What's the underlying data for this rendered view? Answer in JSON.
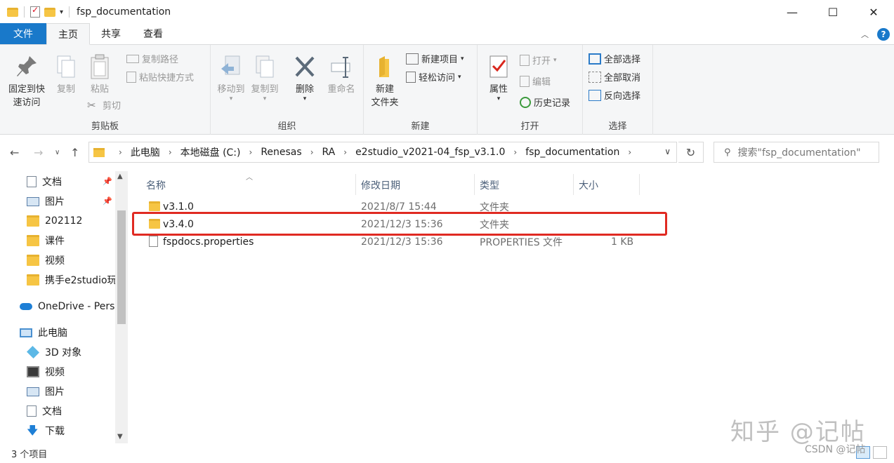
{
  "window": {
    "title": "fsp_documentation",
    "controls": {
      "minimize": "—",
      "maximize": "☐",
      "close": "✕"
    }
  },
  "tabs": [
    {
      "label": "文件"
    },
    {
      "label": "主页"
    },
    {
      "label": "共享"
    },
    {
      "label": "查看"
    }
  ],
  "ribbon": {
    "clipboard": {
      "label": "剪贴板",
      "pin_quick": "固定到快\n速访问",
      "pin_quick_line1": "固定到快",
      "pin_quick_line2": "速访问",
      "copy": "复制",
      "paste": "粘贴",
      "copy_path": "复制路径",
      "paste_shortcut": "粘贴快捷方式",
      "cut": "剪切"
    },
    "organize": {
      "label": "组织",
      "move_to": "移动到",
      "copy_to": "复制到",
      "delete": "删除",
      "rename": "重命名"
    },
    "new": {
      "label": "新建",
      "new_folder_line1": "新建",
      "new_folder_line2": "文件夹",
      "new_item": "新建项目",
      "easy_access": "轻松访问"
    },
    "open": {
      "label": "打开",
      "properties": "属性",
      "open": "打开",
      "edit": "编辑",
      "history": "历史记录"
    },
    "select": {
      "label": "选择",
      "select_all": "全部选择",
      "select_none": "全部取消",
      "invert": "反向选择"
    }
  },
  "address": {
    "breadcrumbs": [
      "此电脑",
      "本地磁盘 (C:)",
      "Renesas",
      "RA",
      "e2studio_v2021-04_fsp_v3.1.0",
      "fsp_documentation"
    ],
    "search_placeholder": "搜索\"fsp_documentation\""
  },
  "nav_pane": {
    "quick": [
      {
        "label": "文档",
        "icon": "documents-icon",
        "pinned": true
      },
      {
        "label": "图片",
        "icon": "pictures-icon",
        "pinned": true
      },
      {
        "label": "202112",
        "icon": "folder-icon",
        "pinned": false
      },
      {
        "label": "课件",
        "icon": "folder-icon",
        "pinned": false
      },
      {
        "label": "视频",
        "icon": "folder-icon",
        "pinned": false
      },
      {
        "label": "携手e2studio玩",
        "icon": "folder-icon",
        "pinned": false
      }
    ],
    "onedrive": "OneDrive - Perso",
    "this_pc": "此电脑",
    "pc_items": [
      {
        "label": "3D 对象",
        "icon": "3d-objects-icon"
      },
      {
        "label": "视频",
        "icon": "videos-icon"
      },
      {
        "label": "图片",
        "icon": "pictures-icon"
      },
      {
        "label": "文档",
        "icon": "documents-icon"
      },
      {
        "label": "下载",
        "icon": "downloads-icon"
      }
    ]
  },
  "file_list": {
    "columns": {
      "name": "名称",
      "date": "修改日期",
      "type": "类型",
      "size": "大小"
    },
    "rows": [
      {
        "name": "v3.1.0",
        "date": "2021/8/7 15:44",
        "type": "文件夹",
        "size": "",
        "kind": "folder"
      },
      {
        "name": "v3.4.0",
        "date": "2021/12/3 15:36",
        "type": "文件夹",
        "size": "",
        "kind": "folder"
      },
      {
        "name": "fspdocs.properties",
        "date": "2021/12/3 15:36",
        "type": "PROPERTIES 文件",
        "size": "1 KB",
        "kind": "file"
      }
    ]
  },
  "status": {
    "item_count": "3 个项目"
  },
  "watermark": {
    "main": "知乎 @记帖",
    "sub": "CSDN @记帖"
  },
  "colors": {
    "accent": "#1979ca",
    "highlight_box": "#e02a22",
    "folder": "#f6c544"
  }
}
